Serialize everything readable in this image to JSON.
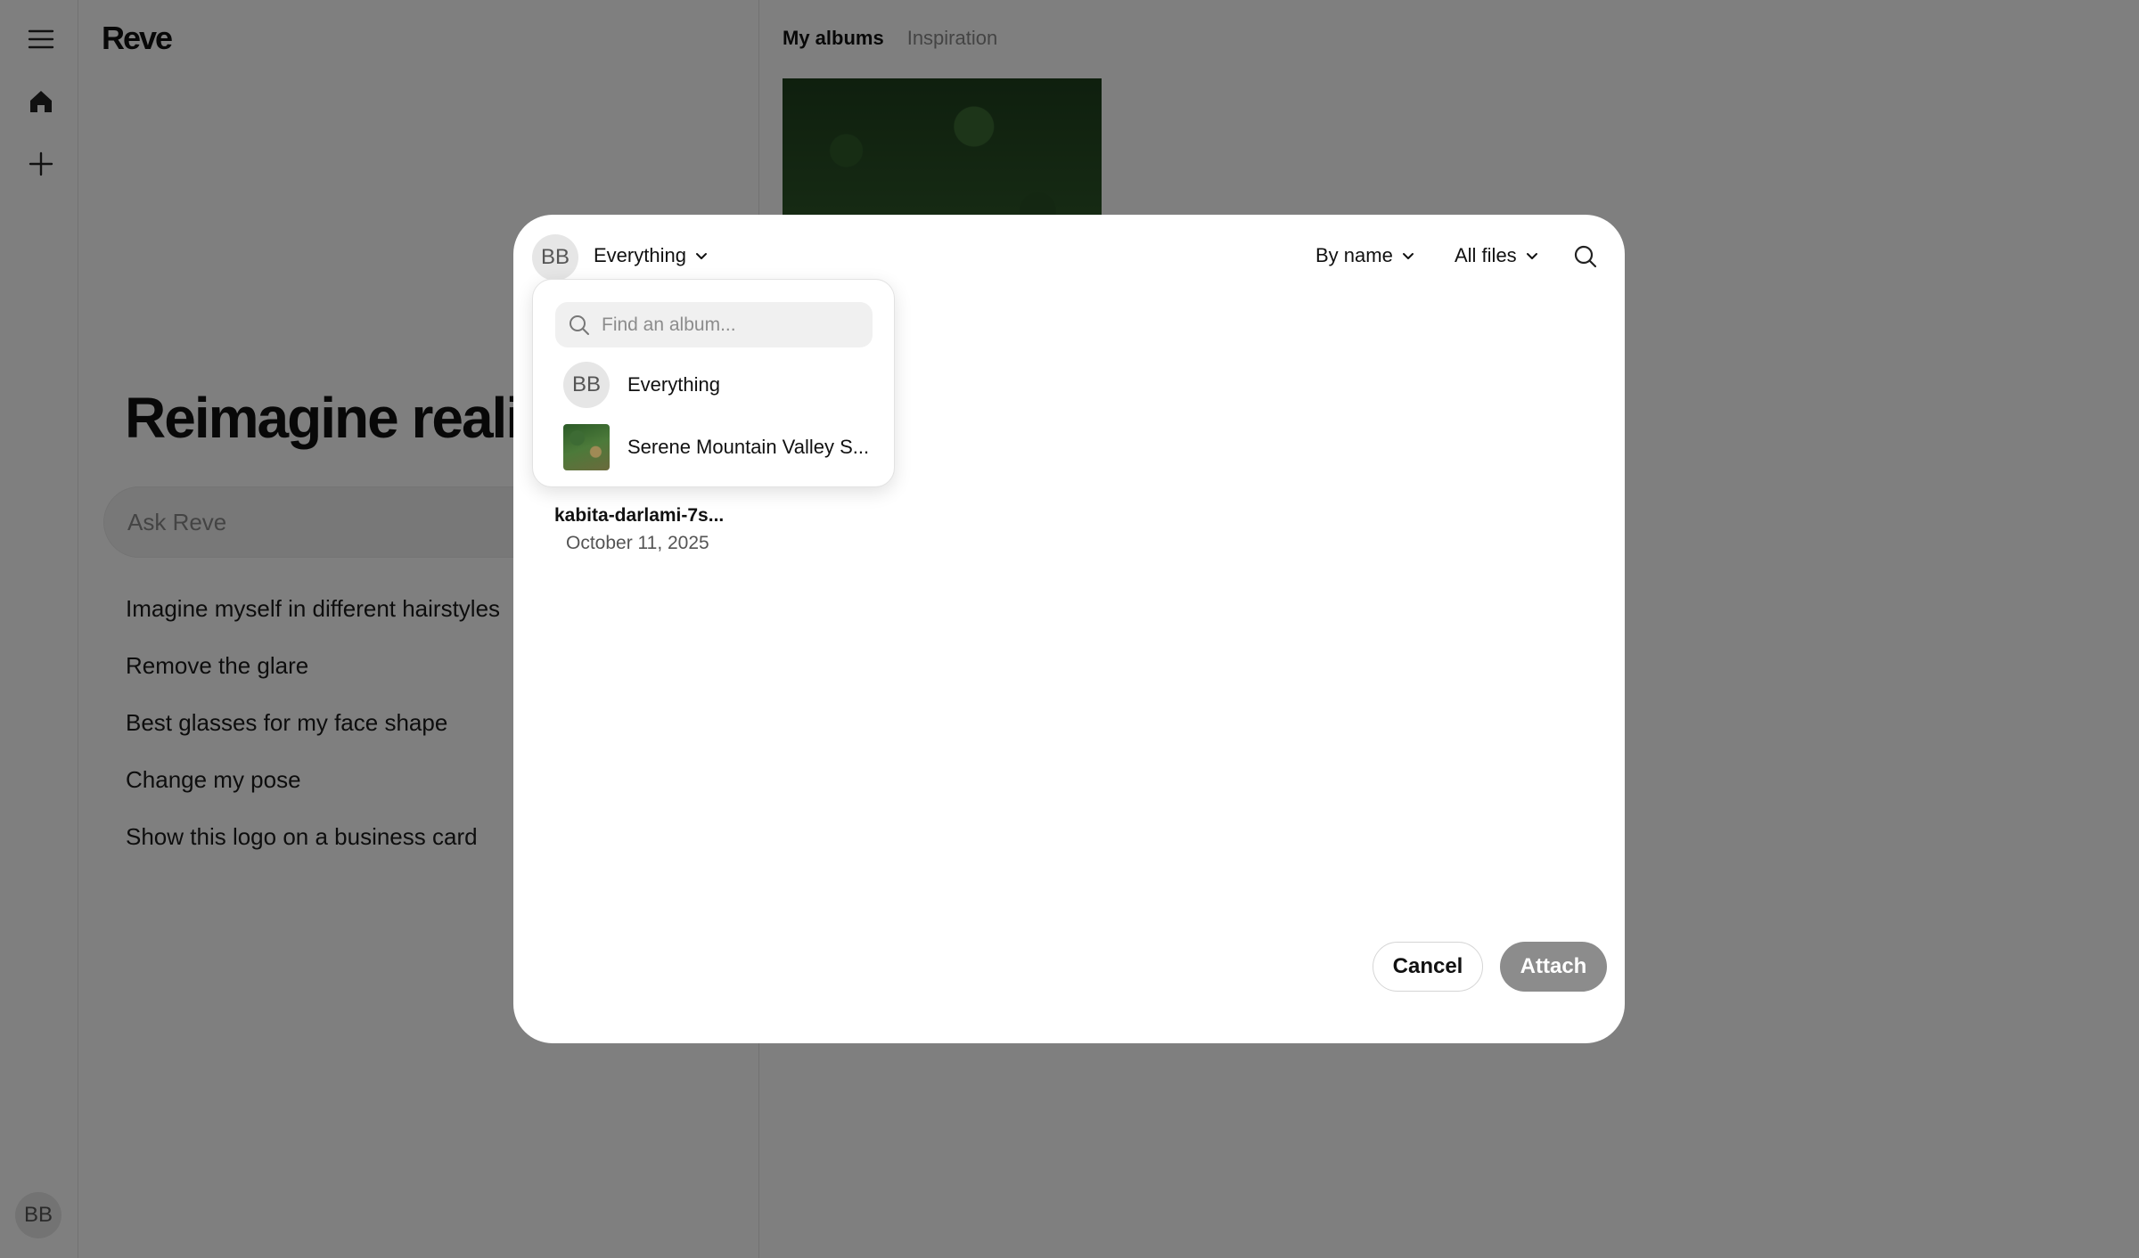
{
  "app": {
    "brand": "Reve",
    "user_initials": "BB"
  },
  "left_panel": {
    "hero_title": "Reimagine realit",
    "ask_placeholder": "Ask Reve",
    "suggestions": [
      "Imagine myself in different hairstyles",
      "Remove the glare",
      "Best glasses for my face shape",
      "Change my pose",
      "Show this logo on a business card"
    ]
  },
  "right_panel": {
    "tabs": [
      {
        "label": "My albums",
        "active": true
      },
      {
        "label": "Inspiration",
        "active": false
      }
    ]
  },
  "modal": {
    "scope_label": "Everything",
    "sort_label": "By name",
    "filter_label": "All files",
    "file": {
      "name": "kabita-darlami-7s...",
      "date": "October 11, 2025"
    },
    "cancel_label": "Cancel",
    "attach_label": "Attach"
  },
  "dropdown": {
    "search_placeholder": "Find an album...",
    "items": [
      {
        "label": "Everything",
        "kind": "avatar",
        "initials": "BB"
      },
      {
        "label": "Serene Mountain Valley S...",
        "kind": "thumbnail"
      }
    ]
  },
  "colors": {
    "overlay": "#808080",
    "attach_disabled": "#8c8c8c"
  }
}
